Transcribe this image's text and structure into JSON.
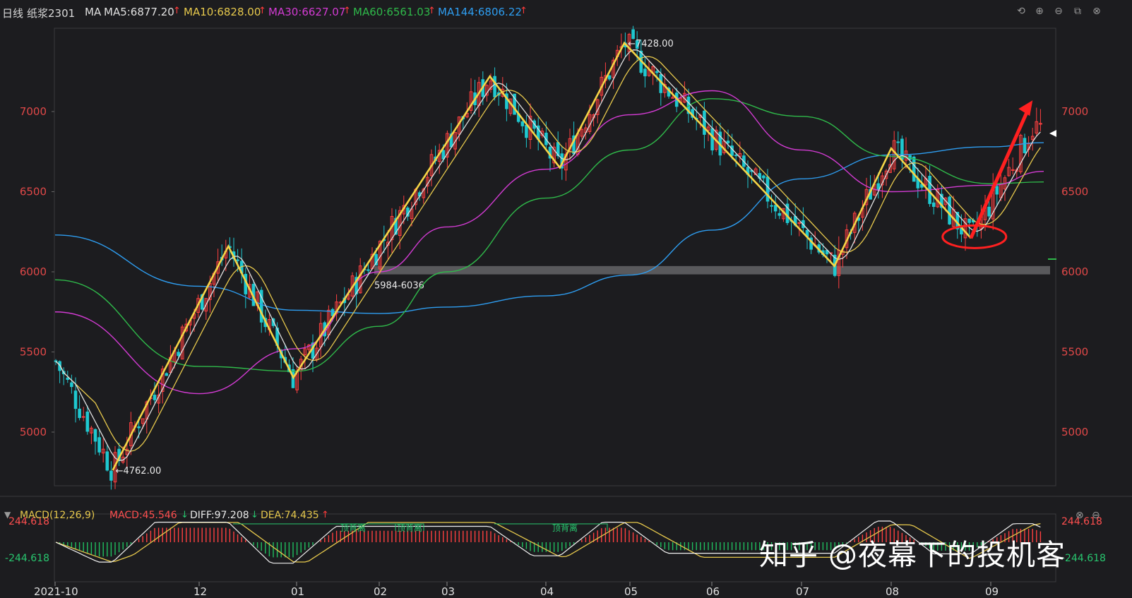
{
  "header": {
    "period": "日线",
    "symbol": "纸浆2301",
    "ma_label": "MA",
    "ma5": "MA5:6877.20",
    "ma10": "MA10:6828.00",
    "ma30": "MA30:6627.07",
    "ma60": "MA60:6561.03",
    "ma144": "MA144:6806.22",
    "up_arrow": "↑",
    "colors": {
      "ma5": "#e0e0e0",
      "ma10": "#e6c84c",
      "ma30": "#d23bd2",
      "ma60": "#2fb94a",
      "ma144": "#2e9df0"
    }
  },
  "toolbar": {
    "icons": [
      "undo-icon",
      "zoom-in-icon",
      "zoom-out-icon",
      "window-icon",
      "close-icon"
    ]
  },
  "macd_header": {
    "label": "MACD(12,26,9)",
    "macd": "MACD:45.546",
    "diff": "DIFF:97.208",
    "dea": "DEA:74.435",
    "down_arrow": "↓",
    "up_arrow": "↑"
  },
  "annotations": {
    "high_label": "←7428.00",
    "low_label": "←4762.00",
    "support_label": "5984-6036",
    "divergence_label": "顶背离",
    "macd_top": "244.618",
    "macd_bottom": "-244.618"
  },
  "watermark": "知乎 @夜幕下的投机客",
  "chart_data": {
    "type": "candlestick",
    "title": "纸浆2301 日线",
    "ylim": [
      4700,
      7500
    ],
    "y_ticks": [
      5000,
      5500,
      6000,
      6500,
      7000
    ],
    "x_ticks": [
      "2021-10",
      "12",
      "01",
      "02",
      "03",
      "04",
      "05",
      "06",
      "07",
      "08",
      "09"
    ],
    "high": 7428.0,
    "low": 4762.0,
    "support_zone": [
      5984,
      6036
    ],
    "zigzag": [
      {
        "x": "2021-10-25",
        "y": 4762
      },
      {
        "x": "2021-12-10",
        "y": 6160
      },
      {
        "x": "2021-12-30",
        "y": 5340
      },
      {
        "x": "2022-03-14",
        "y": 7220
      },
      {
        "x": "2022-04-06",
        "y": 6650
      },
      {
        "x": "2022-04-29",
        "y": 7428
      },
      {
        "x": "2022-07-12",
        "y": 6036
      },
      {
        "x": "2022-08-01",
        "y": 6770
      },
      {
        "x": "2022-08-25",
        "y": 6210
      }
    ],
    "trend_arrow": {
      "from": {
        "x": "2022-08-25",
        "y": 6210
      },
      "to": {
        "x": "2022-09-15",
        "y": 7070
      }
    },
    "ellipse_center": {
      "x": "2022-08-25",
      "y": 6210
    },
    "ma_anchor": {
      "ma144": [
        {
          "x": "2021-10",
          "y": 6230
        },
        {
          "x": "12",
          "y": 5910
        },
        {
          "x": "01",
          "y": 5760
        },
        {
          "x": "02",
          "y": 5740
        },
        {
          "x": "03",
          "y": 5780
        },
        {
          "x": "04",
          "y": 5850
        },
        {
          "x": "05",
          "y": 5980
        },
        {
          "x": "06",
          "y": 6260
        },
        {
          "x": "07",
          "y": 6580
        },
        {
          "x": "08",
          "y": 6730
        },
        {
          "x": "09",
          "y": 6780
        },
        {
          "x": "end",
          "y": 6806
        }
      ],
      "ma60": [
        {
          "x": "2021-10",
          "y": 5950
        },
        {
          "x": "12",
          "y": 5410
        },
        {
          "x": "01",
          "y": 5380
        },
        {
          "x": "02",
          "y": 5660
        },
        {
          "x": "03",
          "y": 6000
        },
        {
          "x": "04",
          "y": 6460
        },
        {
          "x": "05",
          "y": 6760
        },
        {
          "x": "06",
          "y": 7080
        },
        {
          "x": "07",
          "y": 6970
        },
        {
          "x": "08",
          "y": 6720
        },
        {
          "x": "09",
          "y": 6550
        },
        {
          "x": "end",
          "y": 6561
        }
      ],
      "ma30": [
        {
          "x": "2021-10",
          "y": 5750
        },
        {
          "x": "12",
          "y": 5240
        },
        {
          "x": "01",
          "y": 5520
        },
        {
          "x": "02",
          "y": 6000
        },
        {
          "x": "03",
          "y": 6280
        },
        {
          "x": "04",
          "y": 6640
        },
        {
          "x": "05",
          "y": 6980
        },
        {
          "x": "06",
          "y": 7130
        },
        {
          "x": "07",
          "y": 6760
        },
        {
          "x": "08",
          "y": 6500
        },
        {
          "x": "09",
          "y": 6540
        },
        {
          "x": "end",
          "y": 6627
        }
      ]
    },
    "macd": {
      "ylim": [
        -244.618,
        244.618
      ],
      "divergence_boxes": [
        "顶背离",
        "顶背离",
        "顶背离"
      ]
    }
  }
}
